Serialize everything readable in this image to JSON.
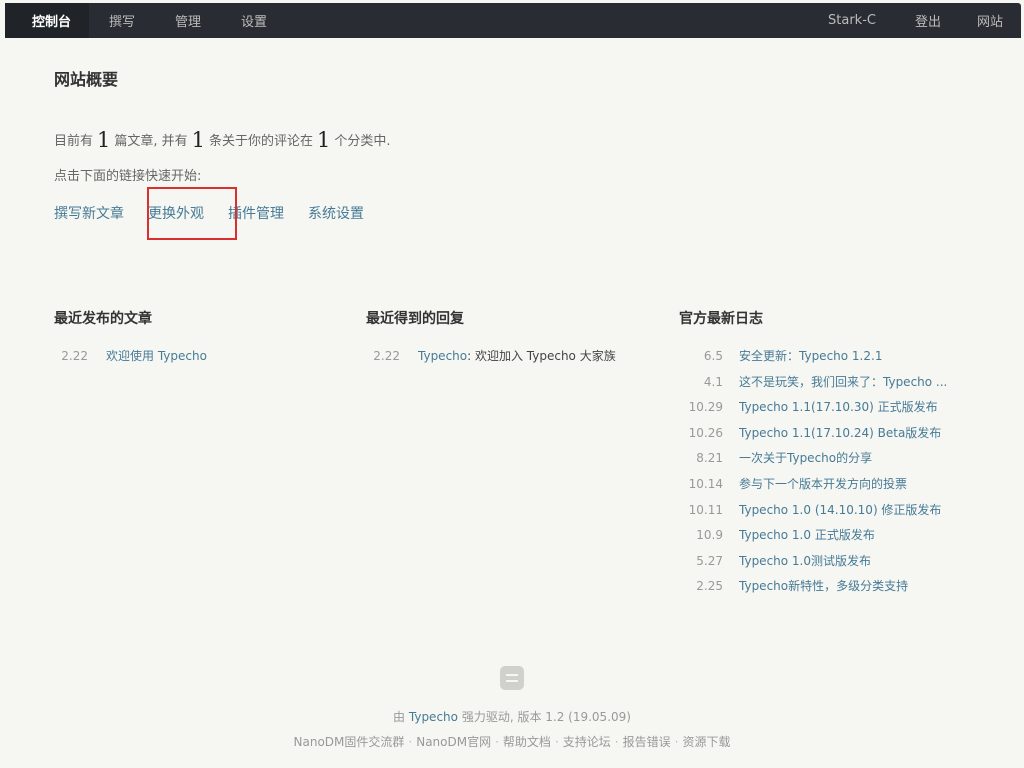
{
  "nav": {
    "left": [
      "控制台",
      "撰写",
      "管理",
      "设置"
    ],
    "right": {
      "user": "Stark-C",
      "logout": "登出",
      "site": "网站"
    }
  },
  "overview": {
    "title": "网站概要",
    "summary": {
      "part1": "目前有",
      "posts": "1",
      "part2": "篇文章, 并有",
      "comments": "1",
      "part3": "条关于你的评论在",
      "categories": "1",
      "part4": "个分类中."
    },
    "hint": "点击下面的链接快速开始:",
    "quick_links": [
      "撰写新文章",
      "更换外观",
      "插件管理",
      "系统设置"
    ]
  },
  "recent_posts": {
    "heading": "最近发布的文章",
    "items": [
      {
        "date": "2.22",
        "title": "欢迎使用 Typecho"
      }
    ]
  },
  "recent_replies": {
    "heading": "最近得到的回复",
    "items": [
      {
        "date": "2.22",
        "author": "Typecho",
        "text": ": 欢迎加入 Typecho 大家族"
      }
    ]
  },
  "official_log": {
    "heading": "官方最新日志",
    "items": [
      {
        "date": "6.5",
        "title": "安全更新：Typecho 1.2.1"
      },
      {
        "date": "4.1",
        "title": "这不是玩笑，我们回来了：Typecho ..."
      },
      {
        "date": "10.29",
        "title": "Typecho 1.1(17.10.30) 正式版发布"
      },
      {
        "date": "10.26",
        "title": "Typecho 1.1(17.10.24) Beta版发布"
      },
      {
        "date": "8.21",
        "title": "一次关于Typecho的分享"
      },
      {
        "date": "10.14",
        "title": "参与下一个版本开发方向的投票"
      },
      {
        "date": "10.11",
        "title": "Typecho 1.0 (14.10.10) 修正版发布"
      },
      {
        "date": "10.9",
        "title": "Typecho 1.0 正式版发布"
      },
      {
        "date": "5.27",
        "title": "Typecho 1.0测试版发布"
      },
      {
        "date": "2.25",
        "title": "Typecho新特性，多级分类支持"
      }
    ]
  },
  "footer": {
    "prefix": "由",
    "brand": "Typecho",
    "suffix": "强力驱动, 版本 1.2 (19.05.09)",
    "links": [
      "NanoDM固件交流群",
      "NanoDM官网",
      "帮助文档",
      "支持论坛",
      "报告错误",
      "资源下载"
    ]
  },
  "colors": {
    "nav_bg": "#292d33",
    "link": "#467b96",
    "highlight": "#d9302f"
  }
}
